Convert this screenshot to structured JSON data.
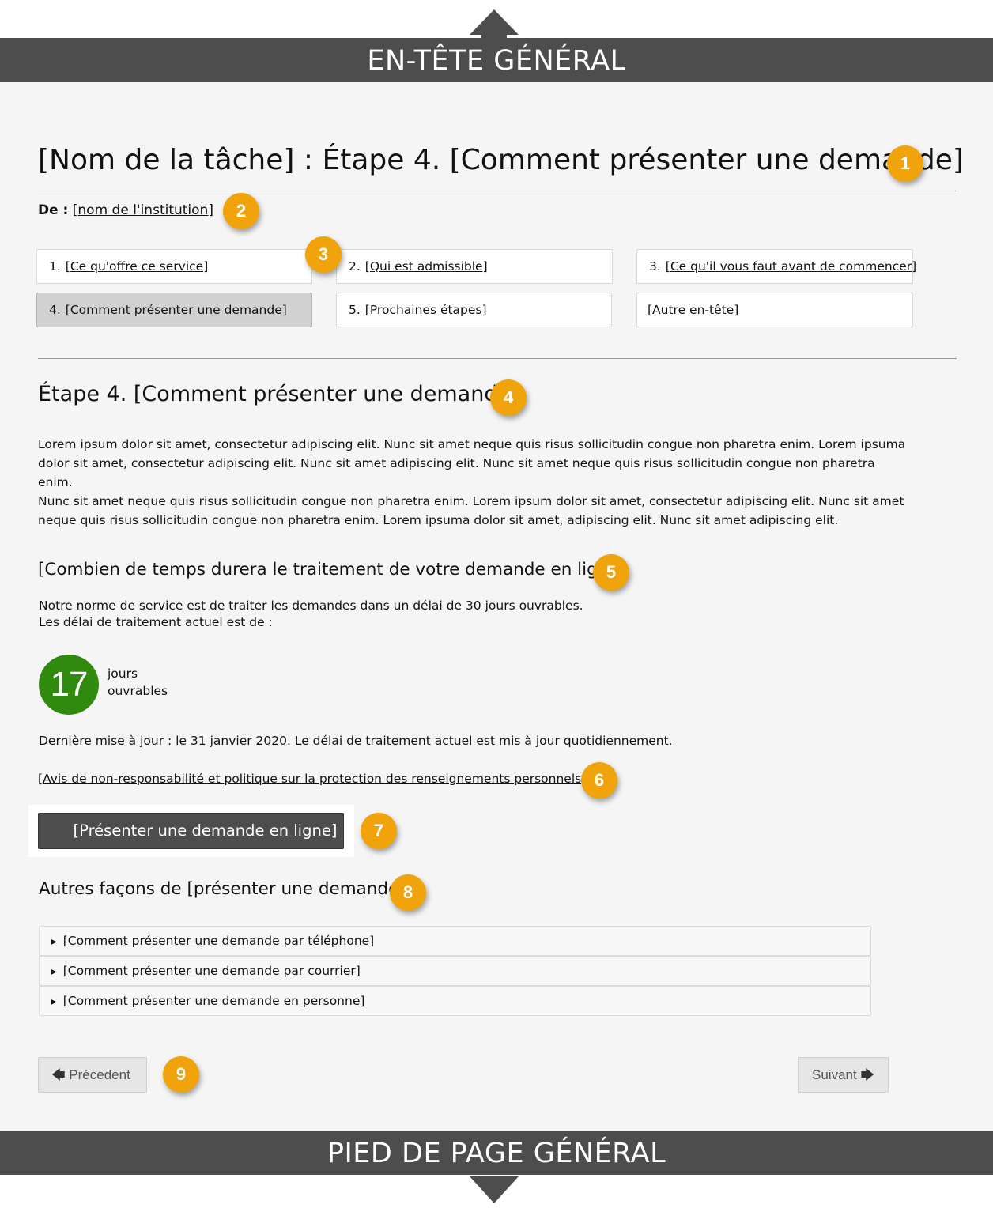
{
  "header": {
    "label": "EN-TÊTE GÉNÉRAL"
  },
  "footer": {
    "label": "PIED DE PAGE GÉNÉRAL"
  },
  "page": {
    "title": "[Nom de la tâche] : Étape 4. [Comment présenter une demande]",
    "from_label": "De :",
    "from_link": "[nom de l'institution]"
  },
  "steps": [
    {
      "num": "1.",
      "label": "[Ce qu'offre ce service]",
      "active": false
    },
    {
      "num": "2.",
      "label": "[Qui est admissible]",
      "active": false
    },
    {
      "num": "3.",
      "label": "[Ce qu'il vous faut avant de commencer]",
      "active": false
    },
    {
      "num": "4.",
      "label": "[Comment présenter une demande]",
      "active": true
    },
    {
      "num": "5.",
      "label": "[Prochaines étapes]",
      "active": false
    },
    {
      "num": "",
      "label": "[Autre en-tête]",
      "active": false
    }
  ],
  "section": {
    "title": "Étape 4. [Comment présenter une demande]",
    "para1": "Lorem ipsum dolor sit amet, consectetur adipiscing elit. Nunc sit amet neque quis  risus sollicitudin congue non pharetra enim. Lorem ipsuma dolor sit amet, consectetur adipiscing elit. Nunc sit amet adipiscing elit. Nunc sit amet neque quis risus sollicitudin congue non pharetra enim.",
    "para2": "Nunc sit amet neque quis risus sollicitudin congue non pharetra enim.  Lorem ipsum dolor sit amet, consectetur adipiscing elit. Nunc sit amet neque quis  risus sollicitudin congue non pharetra enim. Lorem ipsuma dolor sit amet, adipiscing elit. Nunc sit amet adipiscing elit."
  },
  "processing": {
    "title": "[Combien de temps durera le traitement de votre demande en ligne]",
    "norm_line1": "Notre norme de service est de traiter les demandes dans un délai de 30 jours ouvrables.",
    "norm_line2": "Les délai de traitement actuel est de :",
    "days_value": "17",
    "days_label_line1": "jours",
    "days_label_line2": "ouvrables",
    "updated": "Dernière mise à jour : le 31 janvier 2020. Le délai de traitement actuel est mis à jour quotidiennement.",
    "privacy_link": "[Avis de non-responsabilité et politique sur la protection des renseignements personnels]"
  },
  "apply_button": {
    "label": "[Présenter une demande en ligne]"
  },
  "other_ways": {
    "title": "Autres façons de [présenter une demande]",
    "items": [
      "[Comment présenter une demande par téléphone]",
      "[Comment présenter une demande par courrier]",
      "[Comment présenter une demande en personne]"
    ]
  },
  "pager": {
    "prev_label": "Précedent",
    "next_label": "Suivant"
  },
  "badges": [
    "1",
    "2",
    "3",
    "4",
    "5",
    "6",
    "7",
    "8",
    "9"
  ],
  "colors": {
    "banner": "#4d4d4d",
    "badge": "#f0a30a",
    "days_circle": "#2f8a0e",
    "active_step": "#d2d2d2"
  }
}
